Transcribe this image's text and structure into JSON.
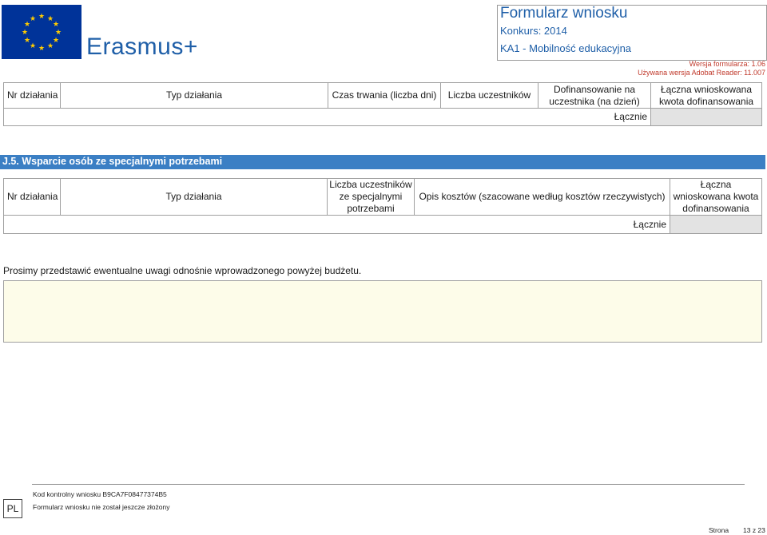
{
  "header": {
    "brand": "Erasmus+",
    "form_title": "Formularz wniosku",
    "konkurs": "Konkurs: 2014",
    "action": "KA1 - Mobilność edukacyjna",
    "version": "Wersja formularza: 1.06",
    "reader": "Używana wersja Adobat Reader: 11.007"
  },
  "table1": {
    "headers": [
      "Nr działania",
      "Typ działania",
      "Czas trwania (liczba dni)",
      "Liczba uczestników",
      "Dofinansowanie na uczestnika (na dzień)",
      "Łączna wnioskowana kwota dofinansowania"
    ],
    "total_label": "Łącznie"
  },
  "section_j5": {
    "title": "J.5. Wsparcie osób ze specjalnymi potrzebami",
    "headers": [
      "Nr działania",
      "Typ działania",
      "Liczba uczestników ze specjalnymi potrzebami",
      "Opis kosztów (szacowane według kosztów rzeczywistych)",
      "Łączna wnioskowana kwota dofinansowania"
    ],
    "total_label": "Łącznie"
  },
  "notes": {
    "prompt": "Prosimy przedstawić ewentualne uwagi odnośnie wprowadzonego powyżej budżetu."
  },
  "footer": {
    "lang": "PL",
    "control_label": "Kod kontrolny wniosku",
    "control_code": "B9CA7F08477374B5",
    "status": "Formularz wniosku nie został jeszcze złożony",
    "page_label": "Strona",
    "page_num": "13 z 23"
  },
  "colors": {
    "brand_blue": "#1f5fa8",
    "section_bar": "#3b7fc4",
    "version_red": "#c0392b",
    "notes_bg": "#fdfce9"
  }
}
